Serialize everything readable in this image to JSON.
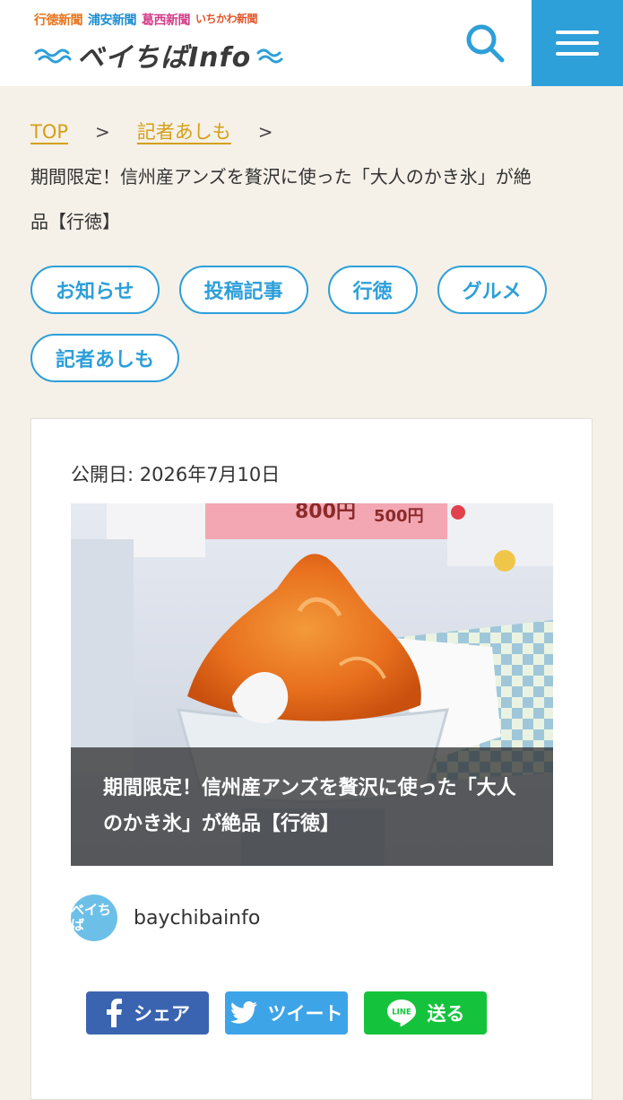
{
  "header": {
    "papers": [
      "行徳新聞",
      "浦安新聞",
      "葛西新聞",
      "いちかわ新聞"
    ],
    "brand": "ベイちばInfo",
    "colors": {
      "accent": "#2d9fd9",
      "header_bg": "#ffffff",
      "page_bg": "#f5f0e8"
    },
    "icons": {
      "search": "search-icon",
      "menu": "hamburger-menu-icon"
    }
  },
  "breadcrumb": {
    "top": "TOP",
    "author": "記者あしも",
    "separator": ">",
    "current": "期間限定！信州産アンズを贅沢に使った「大人のかき氷」が絶品【行徳】"
  },
  "tags": [
    "お知らせ",
    "投稿記事",
    "行徳",
    "グルメ",
    "記者あしも"
  ],
  "article": {
    "published": "公開日: 2026年7月10日",
    "hero_title": "期間限定！信州産アンズを贅沢に使った「大人のかき氷」が絶品【行徳】",
    "hero_signs": [
      "800円",
      "500円"
    ],
    "author_avatar": "ベイちば",
    "author_name": "baychibainfo"
  },
  "share": {
    "facebook": "シェア",
    "twitter": "ツイート",
    "line": "送る",
    "line_logo": "LINE",
    "colors": {
      "facebook": "#3b64b0",
      "twitter": "#3ea4e8",
      "line": "#14c33b"
    }
  }
}
